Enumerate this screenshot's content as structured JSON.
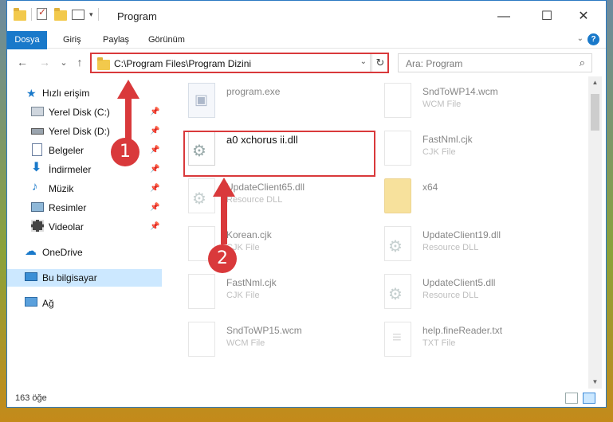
{
  "window": {
    "title": "Program",
    "qa_dropdown": "▾",
    "minimize": "—",
    "maximize": "☐",
    "close": "✕"
  },
  "ribbon": {
    "tabs": [
      "Dosya",
      "Giriş",
      "Paylaş",
      "Görünüm"
    ],
    "collapse": "⌄",
    "help": "?"
  },
  "nav": {
    "back": "←",
    "forward": "→",
    "recent": "⌄",
    "up": "↑",
    "address": "C:\\Program Files\\Program Dizini",
    "address_chevron": "⌄",
    "refresh": "↻",
    "search_placeholder": "Ara: Program",
    "search_icon": "⌕"
  },
  "sidebar": {
    "items": [
      {
        "label": "Hızlı erişim",
        "icon": "star-icon",
        "pinned": false
      },
      {
        "label": "Yerel Disk (C:)",
        "icon": "drive-icon",
        "pinned": true
      },
      {
        "label": "Yerel Disk (D:)",
        "icon": "drive-icon",
        "pinned": true
      },
      {
        "label": "Belgeler",
        "icon": "documents-icon",
        "pinned": true
      },
      {
        "label": "İndirmeler",
        "icon": "download-icon",
        "pinned": true
      },
      {
        "label": "Müzik",
        "icon": "music-icon",
        "pinned": true
      },
      {
        "label": "Resimler",
        "icon": "pictures-icon",
        "pinned": true
      },
      {
        "label": "Videolar",
        "icon": "video-icon",
        "pinned": true
      },
      {
        "label": "OneDrive",
        "icon": "cloud-icon",
        "pinned": false
      },
      {
        "label": "Bu bilgisayar",
        "icon": "computer-icon",
        "pinned": false,
        "selected": true
      },
      {
        "label": "Ağ",
        "icon": "network-icon",
        "pinned": false
      }
    ],
    "pin_glyph": "📌"
  },
  "files": [
    {
      "name": "program.exe",
      "type": "",
      "icon": "exe"
    },
    {
      "name": "SndToWP14.wcm",
      "type": "WCM File",
      "icon": "blank"
    },
    {
      "name": "a0 xchorus ii.dll",
      "type": "",
      "icon": "gear",
      "highlighted": true
    },
    {
      "name": "FastNml.cjk",
      "type": "CJK File",
      "icon": "blank"
    },
    {
      "name": "UpdateClient65.dll",
      "type": "Resource DLL",
      "icon": "gear"
    },
    {
      "name": "x64",
      "type": "",
      "icon": "folder"
    },
    {
      "name": "Korean.cjk",
      "type": "CJK File",
      "icon": "blank"
    },
    {
      "name": "UpdateClient19.dll",
      "type": "Resource DLL",
      "icon": "gear"
    },
    {
      "name": "FastNml.cjk",
      "type": "CJK File",
      "icon": "blank"
    },
    {
      "name": "UpdateClient5.dll",
      "type": "Resource DLL",
      "icon": "gear"
    },
    {
      "name": "SndToWP15.wcm",
      "type": "WCM File",
      "icon": "blank"
    },
    {
      "name": "help.fineReader.txt",
      "type": "TXT File",
      "icon": "txt"
    }
  ],
  "status": {
    "count": "163 öğe"
  },
  "annotations": {
    "step1": "1",
    "step2": "2",
    "color": "#d9393b"
  },
  "scroll": {
    "up": "▲",
    "down": "▼"
  }
}
